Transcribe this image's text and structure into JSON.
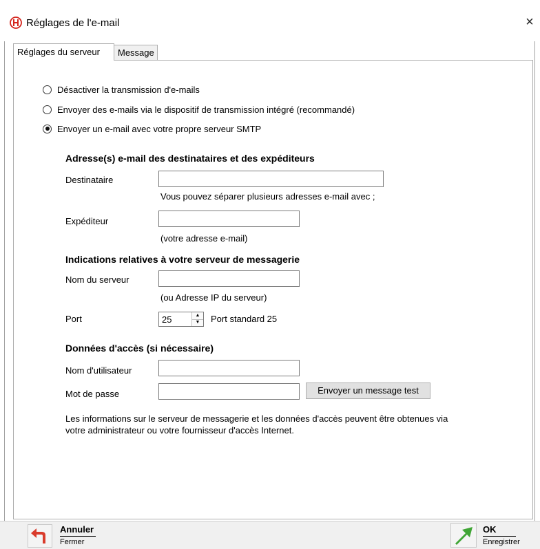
{
  "window": {
    "title": "Réglages de l'e-mail",
    "close_glyph": "×",
    "app_icon": "app-logo-icon"
  },
  "tabs": [
    {
      "label": "Réglages du serveur",
      "active": true
    },
    {
      "label": "Message",
      "active": false
    }
  ],
  "radios": [
    {
      "label": "Désactiver la transmission d'e-mails",
      "checked": false
    },
    {
      "label": "Envoyer des e-mails via le dispositif de transmission intégré (recommandé)",
      "checked": false
    },
    {
      "label": "Envoyer un e-mail avec votre propre serveur SMTP",
      "checked": true
    }
  ],
  "addresses": {
    "heading": "Adresse(s) e-mail des destinataires et des expéditeurs",
    "recipient_label": "Destinataire",
    "recipient_value": "",
    "recipient_hint": "Vous pouvez séparer plusieurs adresses e-mail avec ;",
    "sender_label": "Expéditeur",
    "sender_value": "",
    "sender_hint": "(votre adresse e-mail)"
  },
  "server": {
    "heading": "Indications relatives à votre serveur de messagerie",
    "name_label": "Nom du serveur",
    "name_value": "",
    "name_hint": "(ou Adresse IP du serveur)",
    "port_label": "Port",
    "port_value": "25",
    "port_hint": "Port standard 25"
  },
  "access": {
    "heading": "Données d'accès (si nécessaire)",
    "user_label": "Nom d'utilisateur",
    "user_value": "",
    "password_label": "Mot de passe",
    "password_value": "",
    "test_button": "Envoyer un message test"
  },
  "info": "Les informations sur le serveur de messagerie et les données d'accès peuvent être obtenues via votre administrateur ou votre fournisseur d'accès Internet.",
  "footer": {
    "cancel_title": "Annuler",
    "cancel_sub": "Fermer",
    "ok_title": "OK",
    "ok_sub": "Enregistrer"
  },
  "colors": {
    "cancel_icon": "#d93b2b",
    "ok_icon": "#3fa535",
    "app_icon": "#d4241c"
  }
}
